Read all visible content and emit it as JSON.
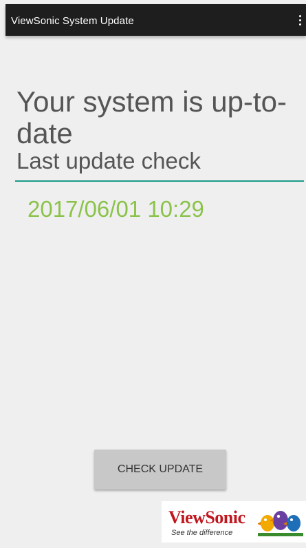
{
  "app": {
    "title": "ViewSonic System Update",
    "overflow_icon": "more-vert-icon"
  },
  "status": {
    "heading": "Your system is up-to-date",
    "last_check_label": "Last update check",
    "last_check_value": "2017/06/01 10:29"
  },
  "actions": {
    "check_update_label": "CHECK UPDATE"
  },
  "brand": {
    "wordmark": "ViewSonic",
    "tagline": "See the difference",
    "mascot_icon": "birds-logo-icon"
  },
  "colors": {
    "titlebar": "#1e1e1e",
    "background": "#efefef",
    "accent_divider": "#1a9a8a",
    "timestamp": "#8bc34a",
    "button": "#c8c8c8",
    "brand_red": "#c0171f"
  }
}
